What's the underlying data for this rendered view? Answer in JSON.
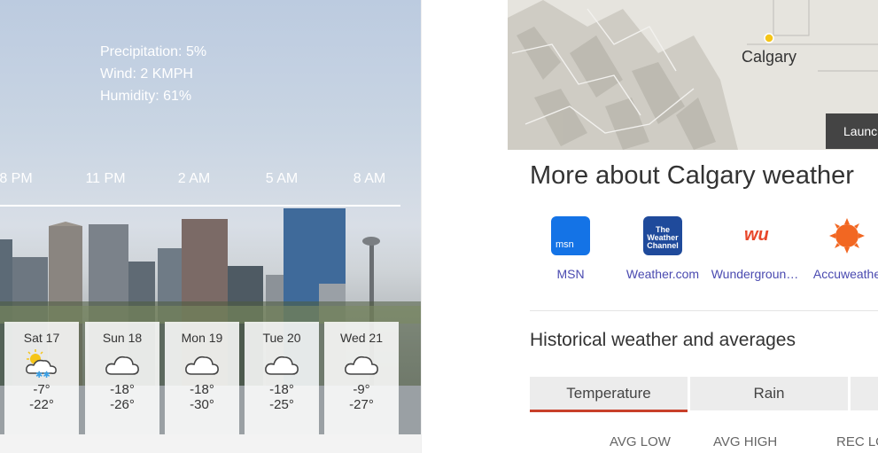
{
  "current": {
    "precipitation": "Precipitation: 5%",
    "wind": "Wind: 2 KMPH",
    "humidity": "Humidity: 61%"
  },
  "hourly": [
    "8 PM",
    "11 PM",
    "2 AM",
    "5 AM",
    "8 AM"
  ],
  "forecast": [
    {
      "day": "Sat 17",
      "high": "-7°",
      "low": "-22°",
      "icon": "partly-sunny-snow-icon"
    },
    {
      "day": "Sun 18",
      "high": "-18°",
      "low": "-26°",
      "icon": "cloud-icon"
    },
    {
      "day": "Mon 19",
      "high": "-18°",
      "low": "-30°",
      "icon": "cloud-icon"
    },
    {
      "day": "Tue 20",
      "high": "-18°",
      "low": "-25°",
      "icon": "cloud-icon"
    },
    {
      "day": "Wed 21",
      "high": "-9°",
      "low": "-27°",
      "icon": "cloud-icon"
    }
  ],
  "map": {
    "city": "Calgary",
    "launch_label": "Launc"
  },
  "more_title": "More about Calgary weather",
  "sources": [
    {
      "name": "MSN",
      "logo_text": "msn",
      "color": "#1473e6"
    },
    {
      "name": "Weather.com",
      "logo_text": "The Weather Channel",
      "color": "#1f4a9b"
    },
    {
      "name": "Wundergroun…",
      "logo_text": "wu",
      "color": "#ffffff"
    },
    {
      "name": "Accuweathe",
      "logo_text": "",
      "color": "#f26722"
    }
  ],
  "historical": {
    "title": "Historical weather and averages",
    "tabs": [
      "Temperature",
      "Rain",
      ""
    ],
    "columns": [
      "AVG LOW",
      "AVG HIGH",
      "REC LO"
    ]
  },
  "colors": {
    "accent": "#c8402a",
    "link": "#4a4ab0"
  }
}
